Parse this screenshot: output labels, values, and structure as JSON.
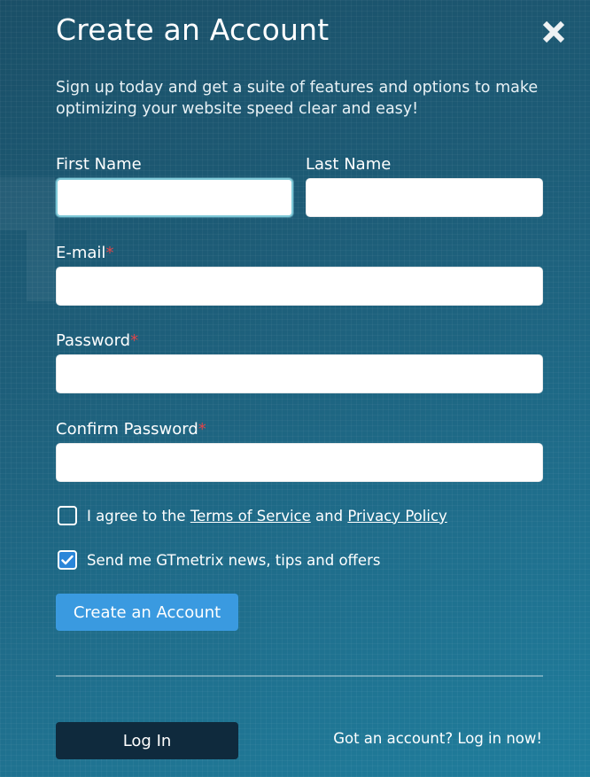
{
  "modal": {
    "title": "Create an Account",
    "subtitle": "Sign up today and get a suite of features and options to make optimizing your website speed clear and easy!"
  },
  "form": {
    "first_name": {
      "label": "First Name",
      "value": "",
      "focused": true
    },
    "last_name": {
      "label": "Last Name",
      "value": ""
    },
    "email": {
      "label": "E-mail",
      "required_mark": "*",
      "value": ""
    },
    "password": {
      "label": "Password",
      "required_mark": "*",
      "value": ""
    },
    "confirm_password": {
      "label": "Confirm Password",
      "required_mark": "*",
      "value": ""
    },
    "agree_terms": {
      "checked": false,
      "text_before": "I agree to the",
      "terms_link": "Terms of Service",
      "text_and": "and",
      "privacy_link": "Privacy Policy"
    },
    "newsletter": {
      "checked": true,
      "label": "Send me GTmetrix news, tips and offers"
    },
    "submit_label": "Create an Account"
  },
  "footer": {
    "login_label": "Log In",
    "login_hint": "Got an account? Log in now!"
  },
  "icons": {
    "close": "close-icon",
    "checkmark": "checkmark-icon"
  },
  "colors": {
    "background": "#1d5c77",
    "primary_button": "#3a9ae0",
    "login_button": "#0f2a3d",
    "required": "#e0454a",
    "checkbox_checked": "#2b86d9"
  }
}
